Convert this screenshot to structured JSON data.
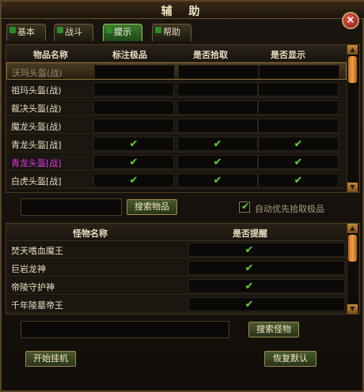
{
  "window": {
    "title": "辅 助",
    "close_icon": "×"
  },
  "tabs": [
    {
      "label": "基本"
    },
    {
      "label": "战斗"
    },
    {
      "label": "提示"
    },
    {
      "label": "帮助"
    }
  ],
  "items_table": {
    "headers": [
      "物品名称",
      "标注极品",
      "是否拾取",
      "是否显示"
    ],
    "rows": [
      {
        "name": "沃玛头盔(战)",
        "c1": false,
        "c2": false,
        "c3": false,
        "selected": true
      },
      {
        "name": "祖玛头盔(战)",
        "c1": false,
        "c2": false,
        "c3": false
      },
      {
        "name": "裁决头盔(战)",
        "c1": false,
        "c2": false,
        "c3": false
      },
      {
        "name": "魔龙头盔(战)",
        "c1": false,
        "c2": false,
        "c3": false
      },
      {
        "name": "青龙头盔[战]",
        "c1": true,
        "c2": true,
        "c3": true
      },
      {
        "name": "青龙头盔[战]",
        "c1": true,
        "c2": true,
        "c3": true,
        "color": "#e035e0"
      },
      {
        "name": "白虎头盔[战]",
        "c1": true,
        "c2": true,
        "c3": true
      }
    ]
  },
  "item_search": {
    "value": "",
    "button_label": "搜索物品"
  },
  "auto_pick": {
    "checked": true,
    "label": "自动优先拾取极品"
  },
  "monsters_table": {
    "headers": [
      "怪物名称",
      "是否提醒"
    ],
    "rows": [
      {
        "name": "焚天嗜血魔王",
        "remind": true
      },
      {
        "name": "巨岩龙神",
        "remind": true
      },
      {
        "name": "帝陵守护神",
        "remind": true
      },
      {
        "name": "千年陵墓帝王",
        "remind": true
      }
    ]
  },
  "monster_search": {
    "value": "",
    "button_label": "搜索怪物"
  },
  "footer": {
    "start_label": "开始挂机",
    "restore_label": "恢复默认"
  },
  "colors": {
    "check": "#5cd632",
    "purple_item": "#e035e0",
    "accent": "#a08a50"
  },
  "icons": {
    "check": "✔",
    "scroll_up": "▲",
    "scroll_down": "▼"
  }
}
